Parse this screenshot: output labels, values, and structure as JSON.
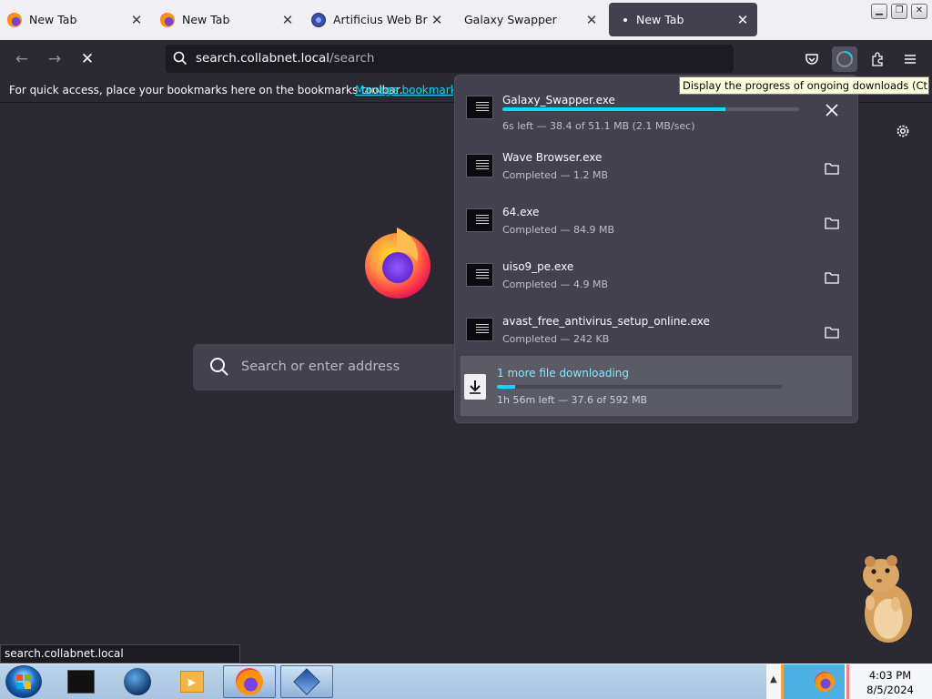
{
  "tabs": [
    {
      "label": "New Tab",
      "icon": "firefox-icon",
      "active": false
    },
    {
      "label": "New Tab",
      "icon": "firefox-icon",
      "active": false
    },
    {
      "label": "Artificius Web Brows",
      "icon": "artificius-icon",
      "active": false
    },
    {
      "label": "Galaxy Swapper",
      "icon": "",
      "active": false
    },
    {
      "label": "New Tab",
      "icon": "dot-icon",
      "active": true
    }
  ],
  "toolbar": {
    "url_host": "search.collabnet.local",
    "url_path": "/search"
  },
  "bookmarks_bar": {
    "message": "For quick access, place your bookmarks here on the bookmarks toolbar.",
    "link": "Manage bookmarks..."
  },
  "tooltip": "Display the progress of ongoing downloads (Ctrl+J)",
  "downloads": {
    "items": [
      {
        "name": "Galaxy_Swapper.exe",
        "status": "6s left — 38.4 of 51.1 MB (2.1 MB/sec)",
        "progress": 0.75,
        "in_progress": true
      },
      {
        "name": "Wave Browser.exe",
        "status": "Completed — 1.2 MB",
        "in_progress": false
      },
      {
        "name": "64.exe",
        "status": "Completed — 84.9 MB",
        "in_progress": false
      },
      {
        "name": "uiso9_pe.exe",
        "status": "Completed — 4.9 MB",
        "in_progress": false
      },
      {
        "name": "avast_free_antivirus_setup_online.exe",
        "status": "Completed — 242 KB",
        "in_progress": false
      }
    ],
    "more": {
      "title": "1 more file downloading",
      "status": "1h 56m left — 37.6 of 592 MB",
      "progress": 0.064
    }
  },
  "newtab": {
    "search_placeholder": "Search or enter address"
  },
  "status_bar": "search.collabnet.local",
  "clock": {
    "time": "4:03 PM",
    "date": "8/5/2024"
  },
  "colors": {
    "accent": "#00ddff",
    "background": "#2b2a33",
    "panel": "#42414d"
  }
}
